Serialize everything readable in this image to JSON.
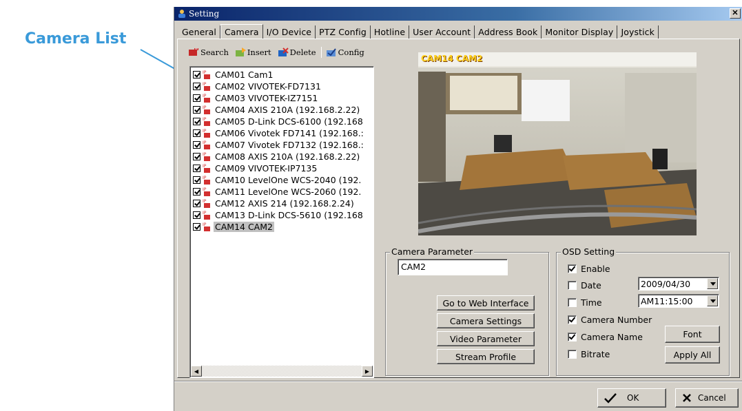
{
  "annotation": {
    "label": "Camera List"
  },
  "window": {
    "title": "Setting"
  },
  "tabs": [
    {
      "label": "General",
      "active": false
    },
    {
      "label": "Camera",
      "active": true
    },
    {
      "label": "I/O Device",
      "active": false
    },
    {
      "label": "PTZ Config",
      "active": false
    },
    {
      "label": "Hotline",
      "active": false
    },
    {
      "label": "User Account",
      "active": false
    },
    {
      "label": "Address Book",
      "active": false
    },
    {
      "label": "Monitor Display",
      "active": false
    },
    {
      "label": "Joystick",
      "active": false
    }
  ],
  "toolbar": {
    "search": "Search",
    "insert": "Insert",
    "delete": "Delete",
    "config": "Config"
  },
  "cameras": [
    {
      "label": "CAM01 Cam1",
      "checked": true
    },
    {
      "label": "CAM02 VIVOTEK-FD7131",
      "checked": true
    },
    {
      "label": "CAM03 VIVOTEK-IZ7151",
      "checked": true
    },
    {
      "label": "CAM04 AXIS 210A (192.168.2.22)",
      "checked": true
    },
    {
      "label": "CAM05 D-Link DCS-6100 (192.168",
      "checked": true
    },
    {
      "label": "CAM06 Vivotek FD7141 (192.168.:",
      "checked": true
    },
    {
      "label": "CAM07 Vivotek FD7132 (192.168.:",
      "checked": true
    },
    {
      "label": "CAM08 AXIS 210A (192.168.2.22)",
      "checked": true
    },
    {
      "label": "CAM09 VIVOTEK-IP7135",
      "checked": true
    },
    {
      "label": "CAM10 LevelOne WCS-2040 (192.",
      "checked": true
    },
    {
      "label": "CAM11 LevelOne WCS-2060 (192.",
      "checked": true
    },
    {
      "label": "CAM12 AXIS 214 (192.168.2.24)",
      "checked": true
    },
    {
      "label": "CAM13 D-Link DCS-5610 (192.168",
      "checked": true
    },
    {
      "label": "CAM14 CAM2",
      "checked": true,
      "selected": true
    }
  ],
  "preview": {
    "osd_text": "CAM14 CAM2"
  },
  "camera_parameter": {
    "legend": "Camera Parameter",
    "name_value": "CAM2",
    "buttons": {
      "web": "Go to Web Interface",
      "settings": "Camera Settings",
      "video": "Video Parameter",
      "stream": "Stream Profile"
    }
  },
  "osd_setting": {
    "legend": "OSD Setting",
    "enable": {
      "label": "Enable",
      "checked": true
    },
    "date": {
      "label": "Date",
      "checked": false,
      "value": "2009/04/30"
    },
    "time": {
      "label": "Time",
      "checked": false,
      "value": "AM11:15:00"
    },
    "camera_number": {
      "label": "Camera Number",
      "checked": true
    },
    "camera_name": {
      "label": "Camera Name",
      "checked": true
    },
    "bitrate": {
      "label": "Bitrate",
      "checked": false
    },
    "font_button": "Font",
    "apply_all_button": "Apply All"
  },
  "footer": {
    "ok": "OK",
    "cancel": "Cancel"
  },
  "colors": {
    "annotation": "#3a9ad9",
    "titlebar": "#0a246a",
    "osd": "#ffd21f",
    "face": "#d4d0c8"
  }
}
